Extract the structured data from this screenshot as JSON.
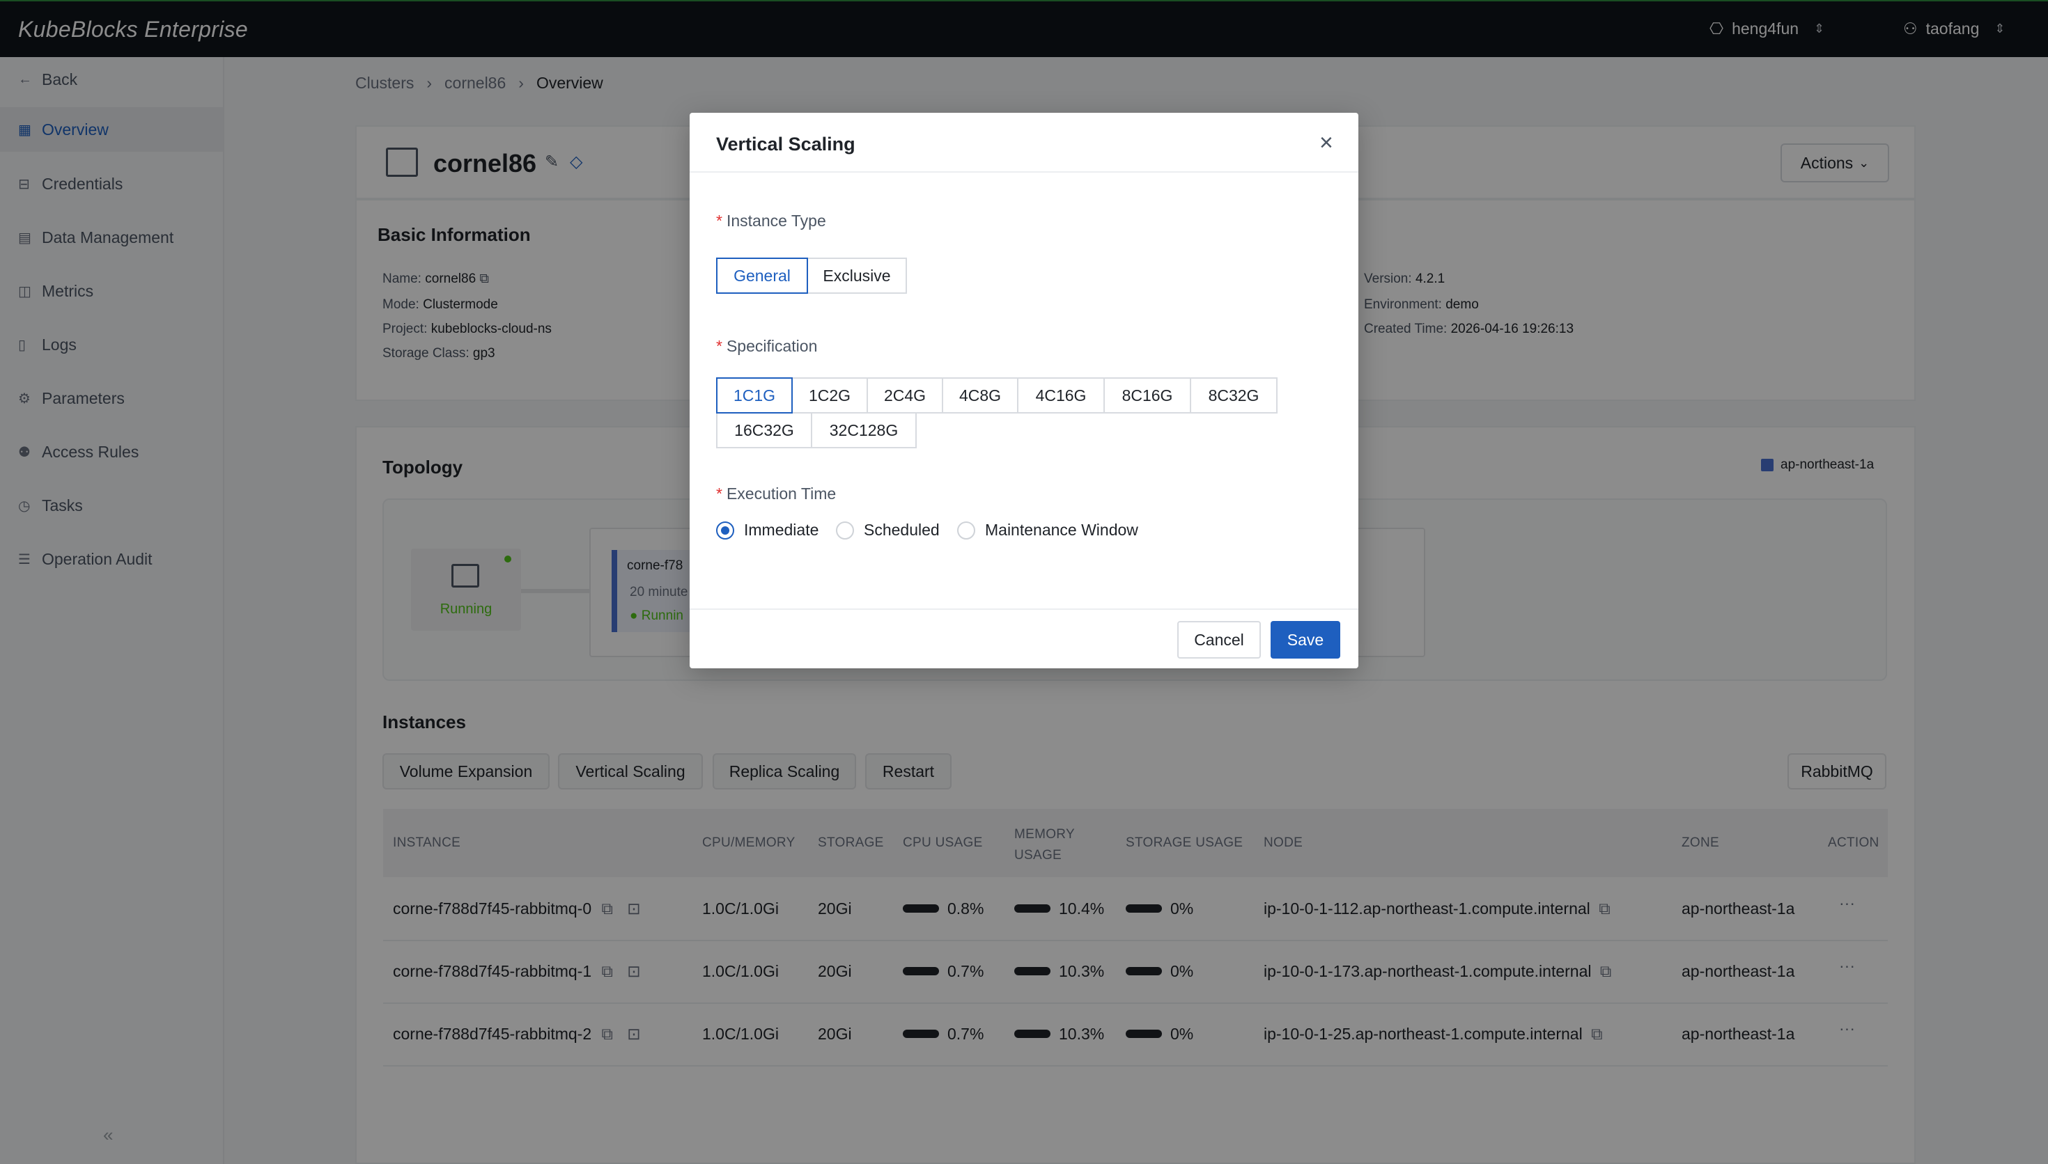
{
  "topbar": {
    "brand": "KubeBlocks Enterprise",
    "org": "heng4fun",
    "user": "taofang"
  },
  "sidebar": {
    "items": [
      {
        "label": "Back",
        "icon": "arrow-left-icon"
      },
      {
        "label": "Overview",
        "icon": "grid-icon"
      },
      {
        "label": "Credentials",
        "icon": "key-icon"
      },
      {
        "label": "Data Management",
        "icon": "database-icon"
      },
      {
        "label": "Metrics",
        "icon": "chart-icon"
      },
      {
        "label": "Logs",
        "icon": "file-icon"
      },
      {
        "label": "Parameters",
        "icon": "gear-icon"
      },
      {
        "label": "Access Rules",
        "icon": "users-icon"
      },
      {
        "label": "Tasks",
        "icon": "clock-icon"
      },
      {
        "label": "Operation Audit",
        "icon": "list-icon"
      }
    ],
    "active_index": 1
  },
  "breadcrumb": [
    "Clusters",
    "cornel86",
    "Overview"
  ],
  "cluster": {
    "name": "cornel86",
    "actions_label": "Actions",
    "basic_title": "Basic Information",
    "name_label": "Name:",
    "name_value": "cornel86",
    "mode_label": "Mode:",
    "mode_value": "Clustermode",
    "project_label": "Project:",
    "project_value": "kubeblocks-cloud-ns",
    "storage_label": "Storage Class:",
    "storage_value": "gp3",
    "version_label": "Version:",
    "version_value": "4.2.1",
    "env_label": "Environment:",
    "env_value": "demo",
    "created_label": "Created Time:",
    "created_value": "2026-04-16 19:26:13"
  },
  "topology": {
    "title": "Topology",
    "zone_legend": "ap-northeast-1a",
    "node_status": "Running",
    "pod_name": "corne-f78",
    "pod_age": "20 minute",
    "pod_status": "Runnin"
  },
  "instances": {
    "title": "Instances",
    "buttons": [
      "Volume Expansion",
      "Vertical Scaling",
      "Replica Scaling",
      "Restart"
    ],
    "component_filter": "RabbitMQ",
    "columns": [
      "INSTANCE",
      "CPU/MEMORY",
      "STORAGE",
      "CPU USAGE",
      "MEMORY USAGE",
      "STORAGE USAGE",
      "NODE",
      "ZONE",
      "ACTION"
    ],
    "rows": [
      {
        "instance": "corne-f788d7f45-rabbitmq-0",
        "cpu_mem": "1.0C/1.0Gi",
        "storage": "20Gi",
        "cpu_usage": "0.8%",
        "mem_usage": "10.4%",
        "storage_usage": "0%",
        "node": "ip-10-0-1-112.ap-northeast-1.compute.internal",
        "zone": "ap-northeast-1a"
      },
      {
        "instance": "corne-f788d7f45-rabbitmq-1",
        "cpu_mem": "1.0C/1.0Gi",
        "storage": "20Gi",
        "cpu_usage": "0.7%",
        "mem_usage": "10.3%",
        "storage_usage": "0%",
        "node": "ip-10-0-1-173.ap-northeast-1.compute.internal",
        "zone": "ap-northeast-1a"
      },
      {
        "instance": "corne-f788d7f45-rabbitmq-2",
        "cpu_mem": "1.0C/1.0Gi",
        "storage": "20Gi",
        "cpu_usage": "0.7%",
        "mem_usage": "10.3%",
        "storage_usage": "0%",
        "node": "ip-10-0-1-25.ap-northeast-1.compute.internal",
        "zone": "ap-northeast-1a"
      }
    ]
  },
  "modal": {
    "title": "Vertical Scaling",
    "instance_type_label": "Instance Type",
    "instance_types": [
      "General",
      "Exclusive"
    ],
    "instance_type_selected": "General",
    "specification_label": "Specification",
    "specifications": [
      "1C1G",
      "1C2G",
      "2C4G",
      "4C8G",
      "4C16G",
      "8C16G",
      "8C32G",
      "16C32G",
      "32C128G"
    ],
    "specification_selected": "1C1G",
    "execution_label": "Execution Time",
    "execution_options": [
      "Immediate",
      "Scheduled",
      "Maintenance Window"
    ],
    "execution_selected": "Immediate",
    "cancel_label": "Cancel",
    "save_label": "Save"
  },
  "colors": {
    "primary": "#1e5fbf",
    "topbar": "#0f141b",
    "running": "#52c41a",
    "required": "#e03131"
  }
}
